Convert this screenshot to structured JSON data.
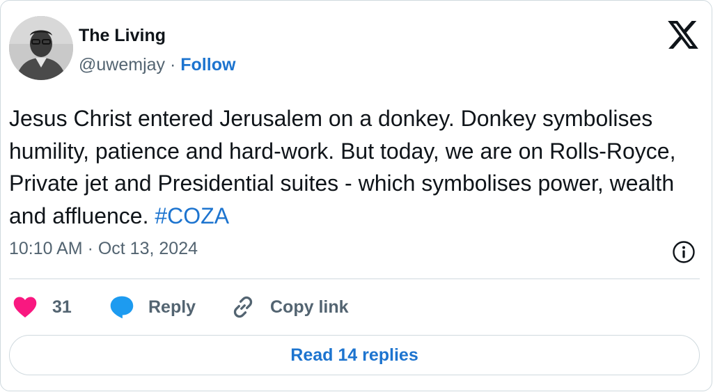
{
  "author": {
    "display_name": "The Living",
    "handle": "@uwemjay",
    "separator": "·",
    "follow_label": "Follow"
  },
  "tweet": {
    "text": "Jesus Christ entered Jerusalem on a donkey. Donkey symbolises humility, patience and hard-work. But today, we are on Rolls-Royce, Private jet and Presidential suites - which symbolises power, wealth and affluence.",
    "hashtag": "#COZA",
    "timestamp": "10:10 AM · Oct 13, 2024"
  },
  "actions": {
    "like_count": "31",
    "reply_label": "Reply",
    "copy_link_label": "Copy link"
  },
  "read_replies_label": "Read 14 replies",
  "icons": {
    "logo": "x-logo-icon",
    "info": "info-icon",
    "like": "heart-icon",
    "reply": "speech-bubble-icon",
    "copy": "link-icon"
  },
  "colors": {
    "accent": "#1d74cf",
    "heart": "#f91880",
    "reply_bubble": "#1d9bf0",
    "secondary_text": "#536471",
    "border": "#cfd9de"
  }
}
